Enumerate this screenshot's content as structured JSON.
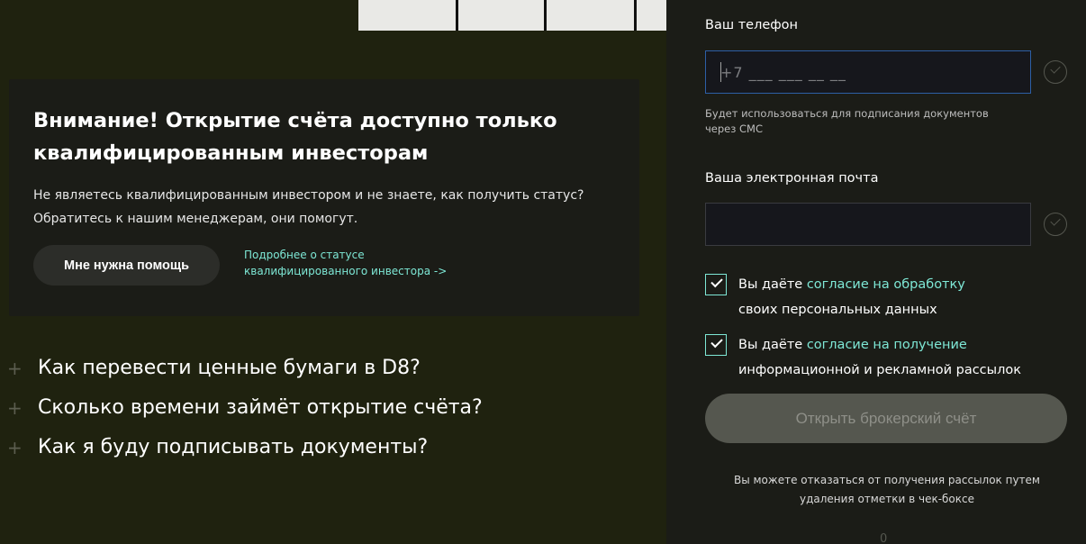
{
  "warning": {
    "title": "Внимание! Открытие счёта доступно только квалифицированным инвесторам",
    "text": "Не являетесь квалифицированным инвестором и не знаете, как получить статус? Обратитесь к нашим менеджерам, они помогут.",
    "help_button": "Мне нужна помощь",
    "status_link": "Подробнее о статусе квалифицированного инвестора ->"
  },
  "faq": [
    {
      "plus": "+",
      "label": "Как перевести ценные бумаги в D8?"
    },
    {
      "plus": "+",
      "label": "Сколько времени займёт открытие счёта?"
    },
    {
      "plus": "+",
      "label": "Как я буду подписывать документы?"
    }
  ],
  "form": {
    "phone_label": "Ваш телефон",
    "phone_placeholder": "+7 ___ ___ __ __",
    "phone_hint": "Будет использоваться для подписания документов через СМС",
    "email_label": "Ваша электронная почта",
    "email_value": "",
    "consent1_prefix": "Вы даёте ",
    "consent1_link": "согласие на обработку",
    "consent1_suffix": "своих персональных данных",
    "consent1_checked": true,
    "consent2_prefix": "Вы даёте ",
    "consent2_link": "согласие на получение",
    "consent2_suffix": "информационной и рекламной рассылок",
    "consent2_checked": true,
    "submit": "Открыть брокерский счёт",
    "footnote": "Вы можете отказаться от получения рассылок путем удаления отметки в чек-боксе",
    "bottom_glyph": "0"
  },
  "colors": {
    "page_bg": "#1f220f",
    "panel_bg": "#1b1c17",
    "accent": "#7ee8d6",
    "input_focus": "#2d5fa6",
    "disabled_button": "#55574f"
  }
}
